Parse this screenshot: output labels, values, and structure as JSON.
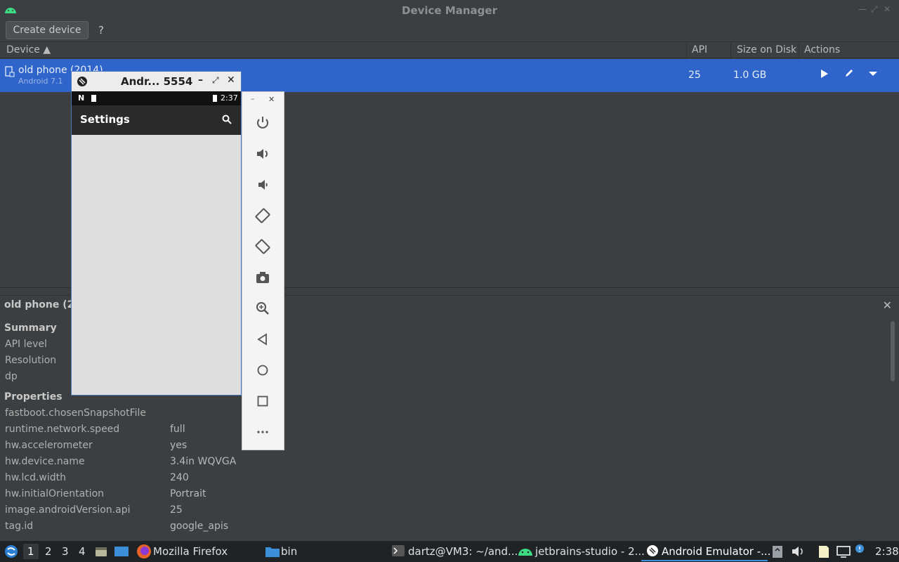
{
  "window": {
    "title": "Device Manager"
  },
  "toolbar": {
    "create_label": "Create device",
    "help_label": "?"
  },
  "table": {
    "headers": {
      "device": "Device ▲",
      "api": "API",
      "size": "Size on Disk",
      "actions": "Actions"
    },
    "row": {
      "name": "old phone (2014)",
      "sub": "Android 7.1",
      "api": "25",
      "size": "1.0 GB"
    }
  },
  "emulator": {
    "title": "Andr... 5554",
    "time": "2:37",
    "app_title": "Settings"
  },
  "details": {
    "title": "old phone (2",
    "summary_heading": "Summary",
    "summary": [
      "API level",
      "Resolution",
      "dp"
    ],
    "properties_heading": "Properties",
    "properties": [
      {
        "key": "fastboot.chosenSnapshotFile",
        "value": ""
      },
      {
        "key": "runtime.network.speed",
        "value": "full"
      },
      {
        "key": "hw.accelerometer",
        "value": "yes"
      },
      {
        "key": "hw.device.name",
        "value": "3.4in WQVGA"
      },
      {
        "key": "hw.lcd.width",
        "value": "240"
      },
      {
        "key": "hw.initialOrientation",
        "value": "Portrait"
      },
      {
        "key": "image.androidVersion.api",
        "value": "25"
      },
      {
        "key": "tag.id",
        "value": "google_apis"
      }
    ]
  },
  "taskbar": {
    "workspaces": [
      "1",
      "2",
      "3",
      "4"
    ],
    "firefox": "Mozilla Firefox",
    "folder": "bin",
    "terminal": "dartz@VM3: ~/and...",
    "studio": "jetbrains-studio - 2...",
    "emulator": "Android Emulator -...",
    "clock": "2:38"
  },
  "colors": {
    "accent": "#2f65ca",
    "android_green": "#3ddc84"
  }
}
